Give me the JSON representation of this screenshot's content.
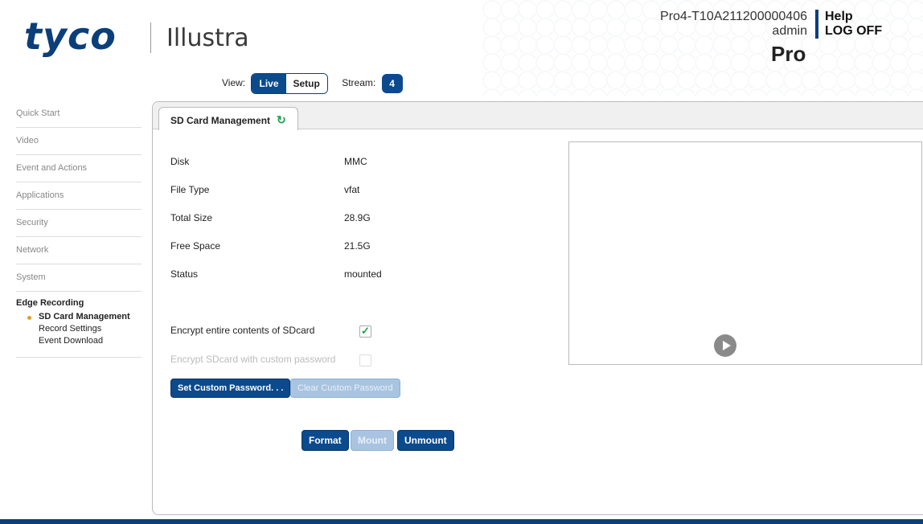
{
  "header": {
    "logo_brand": "tyco",
    "logo_product": "Illustra",
    "device_id": "Pro4-T10A211200000406",
    "user": "admin",
    "help_label": "Help",
    "logoff_label": "LOG OFF",
    "model": "Pro",
    "view_label": "View:",
    "view_live": "Live",
    "view_setup": "Setup",
    "stream_label": "Stream:",
    "stream_value": "4"
  },
  "sidebar": {
    "items": [
      "Quick Start",
      "Video",
      "Event and Actions",
      "Applications",
      "Security",
      "Network",
      "System"
    ],
    "group": "Edge Recording",
    "subitems": [
      "SD Card Management",
      "Record Settings",
      "Event Download"
    ]
  },
  "tab": {
    "label": "SD Card Management"
  },
  "info": {
    "rows": [
      {
        "label": "Disk",
        "value": "MMC"
      },
      {
        "label": "File Type",
        "value": "vfat"
      },
      {
        "label": "Total Size",
        "value": "28.9G"
      },
      {
        "label": "Free Space",
        "value": "21.5G"
      },
      {
        "label": "Status",
        "value": "mounted"
      }
    ]
  },
  "encryption": {
    "encrypt_label": "Encrypt entire contents of SDcard",
    "encrypt_checked": true,
    "custom_pw_label": "Encrypt SDcard with custom password",
    "set_pw_button": "Set Custom Password. . .",
    "clear_pw_button": "Clear Custom Password"
  },
  "actions": {
    "format": "Format",
    "mount": "Mount",
    "unmount": "Unmount"
  },
  "colors": {
    "brand": "#0b3f7a",
    "button": "#0b4a8c",
    "check": "#1aa34a",
    "active_dot": "#e0a020"
  }
}
